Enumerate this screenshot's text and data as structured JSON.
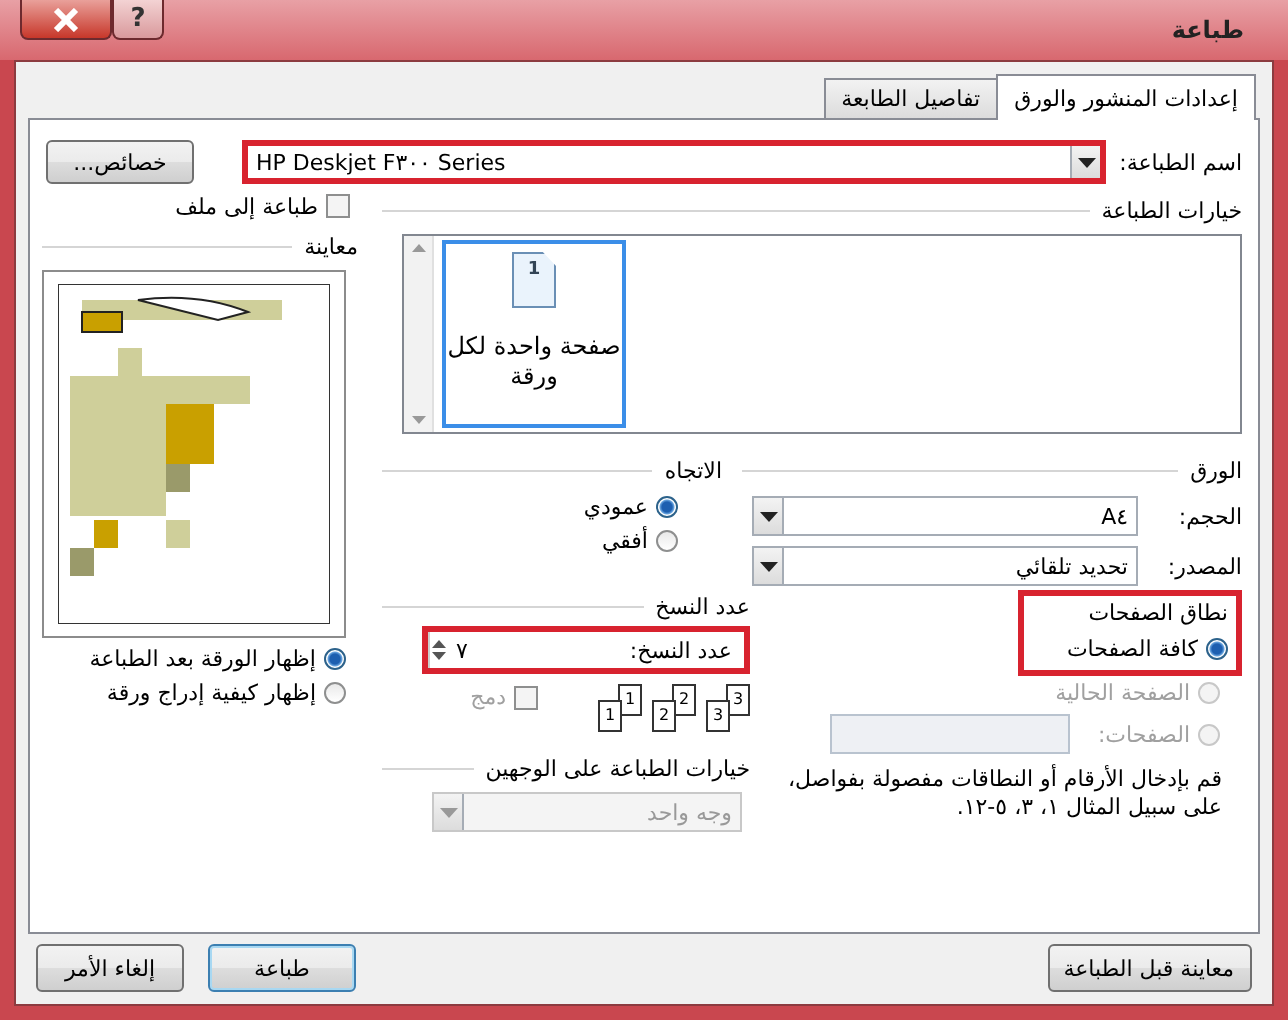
{
  "window": {
    "title": "طباعة",
    "help": "?"
  },
  "tabs": [
    {
      "label": "إعدادات المنشور والورق",
      "selected": true
    },
    {
      "label": "تفاصيل الطابعة",
      "selected": false
    }
  ],
  "printer": {
    "label": "اسم الطباعة:",
    "value": "HP Deskjet F٣٠٠ Series",
    "highlighted": true,
    "properties_button": "خصائص..."
  },
  "print_to_file": {
    "label": "طباعة إلى ملف",
    "checked": false
  },
  "print_options": {
    "title": "خيارات الطباعة",
    "items": [
      {
        "label": "صفحة واحدة لكل ورقة",
        "page_number": "1",
        "selected": true
      }
    ]
  },
  "preview": {
    "title": "معاينة",
    "options": [
      {
        "label": "إظهار الورقة بعد الطباعة",
        "selected": true
      },
      {
        "label": "إظهار كيفية إدراج ورقة",
        "selected": false
      }
    ]
  },
  "paper": {
    "title": "الورق",
    "fields": [
      {
        "label": "الحجم:",
        "value": "A٤"
      },
      {
        "label": "المصدر:",
        "value": "تحديد تلقائي"
      }
    ]
  },
  "orientation": {
    "title": "الاتجاه",
    "options": [
      {
        "label": "عمودي",
        "selected": true
      },
      {
        "label": "أفقي",
        "selected": false
      }
    ]
  },
  "page_range": {
    "title": "نطاق الصفحات",
    "highlighted": true,
    "options": [
      {
        "label": "كافة الصفحات",
        "selected": true,
        "disabled": false,
        "kind": "plain"
      },
      {
        "label": "الصفحة الحالية",
        "selected": false,
        "disabled": true,
        "kind": "plain"
      },
      {
        "label": "الصفحات:",
        "selected": false,
        "disabled": true,
        "kind": "field"
      }
    ],
    "hint_lines": [
      "قم بإدخال الأرقام أو النطاقات مفصولة بفواصل،",
      "على سبيل المثال ١، ٣، ٥-١٢."
    ]
  },
  "copies": {
    "title": "عدد النسخ",
    "label": "عدد النسخ:",
    "value": "٧",
    "highlighted": true,
    "collate": {
      "label": "دمج",
      "checked": false,
      "disabled": true
    },
    "collate_pages": [
      {
        "back": "3",
        "front": "3"
      },
      {
        "back": "2",
        "front": "2"
      },
      {
        "back": "1",
        "front": "1"
      }
    ]
  },
  "duplex": {
    "title": "خيارات الطباعة على الوجهين",
    "value": "وجه واحد",
    "disabled": true
  },
  "buttons": [
    {
      "label": "معاينة قبل الطباعة",
      "default": false
    },
    {
      "label": "طباعة",
      "default": true
    },
    {
      "label": "إلغاء الأمر",
      "default": false
    }
  ]
}
